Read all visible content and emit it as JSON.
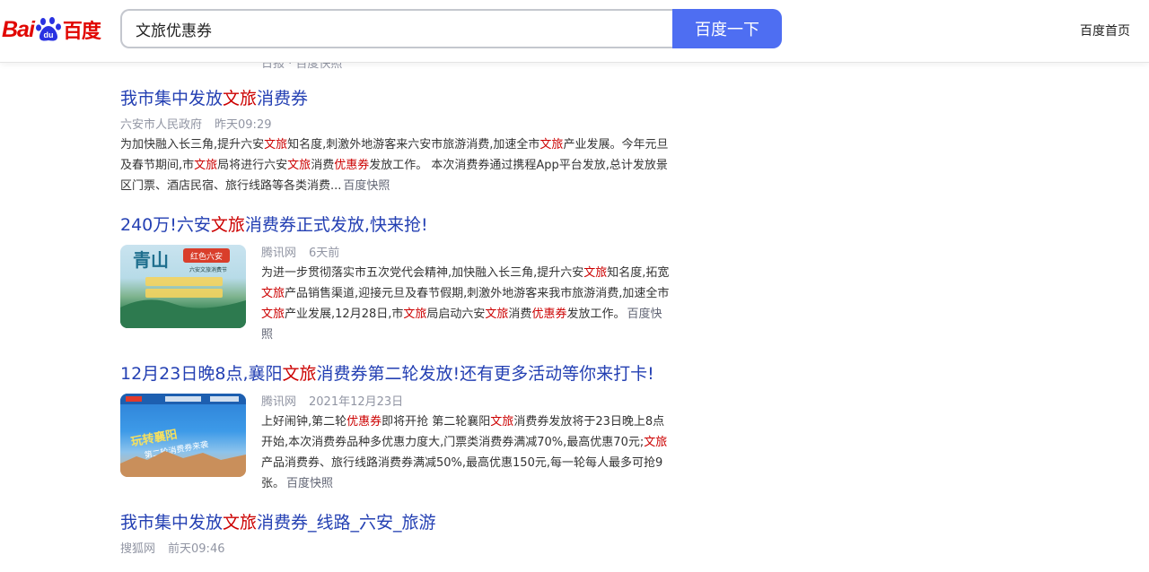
{
  "header": {
    "logo_text_left": "Bai",
    "logo_text_right": "百度",
    "search_value": "文旅优惠券",
    "search_button": "百度一下",
    "home_link": "百度首页"
  },
  "peek_text": "日报 · 百度快照",
  "results": [
    {
      "title_parts": [
        "我市集中发放",
        "文旅",
        "消费券"
      ],
      "source": "六安市人民政府",
      "time": "昨天09:29",
      "desc_parts": [
        "为加快融入长三角,提升六安",
        "文旅",
        "知名度,刺激外地游客来六安市旅游消费,加速全市",
        "文旅",
        "产业发展。今年元旦及春节期间,市",
        "文旅",
        "局将进行六安",
        "文旅",
        "消费",
        "优惠券",
        "发放工作。 本次消费券通过携程App平台发放,总计发放景区门票、酒店民宿、旅行线路等各类消费..."
      ],
      "cache": "百度快照"
    },
    {
      "title_parts": [
        "240万!六安",
        "文旅",
        "消费券正式发放,快来抢!"
      ],
      "source": "腾讯网",
      "time": "6天前",
      "thumb_caption": "青山 红色六安 六安文旅消费节",
      "desc_parts": [
        "为进一步贯彻落实市五次党代会精神,加快融入长三角,提升六安",
        "文旅",
        "知名度,拓宽",
        "文旅",
        "产品销售渠道,迎接元旦及春节假期,刺激外地游客来我市旅游消费,加速全市",
        "文旅",
        "产业发展,12月28日,市",
        "文旅",
        "局启动六安",
        "文旅",
        "消费",
        "优惠券",
        "发放工作。"
      ],
      "cache": "百度快照"
    },
    {
      "title_parts": [
        "12月23日晚8点,襄阳",
        "文旅",
        "消费券第二轮发放!还有更多活动等你来打卡!"
      ],
      "source": "腾讯网",
      "time": "2021年12月23日",
      "desc_parts": [
        "上好闹钟,第二轮",
        "优惠券",
        "即将开抢 第二轮襄阳",
        "文旅",
        "消费券发放将于23日晚上8点开始,本次消费券品种多优惠力度大,门票类消费券满减70%,最高优惠70元;",
        "文旅",
        "产品消费券、旅行线路消费券满减50%,最高优惠150元,每一轮每人最多可抢9张。"
      ],
      "cache": "百度快照"
    },
    {
      "title_parts": [
        "我市集中发放",
        "文旅",
        "消费券_线路_六安_旅游"
      ],
      "source": "搜狐网",
      "time": "前天09:46"
    }
  ],
  "colors": {
    "brand_red": "#e10601",
    "search_blue": "#4e6ef2",
    "title_blue": "#2440b3",
    "highlight_red": "#cc0000"
  }
}
